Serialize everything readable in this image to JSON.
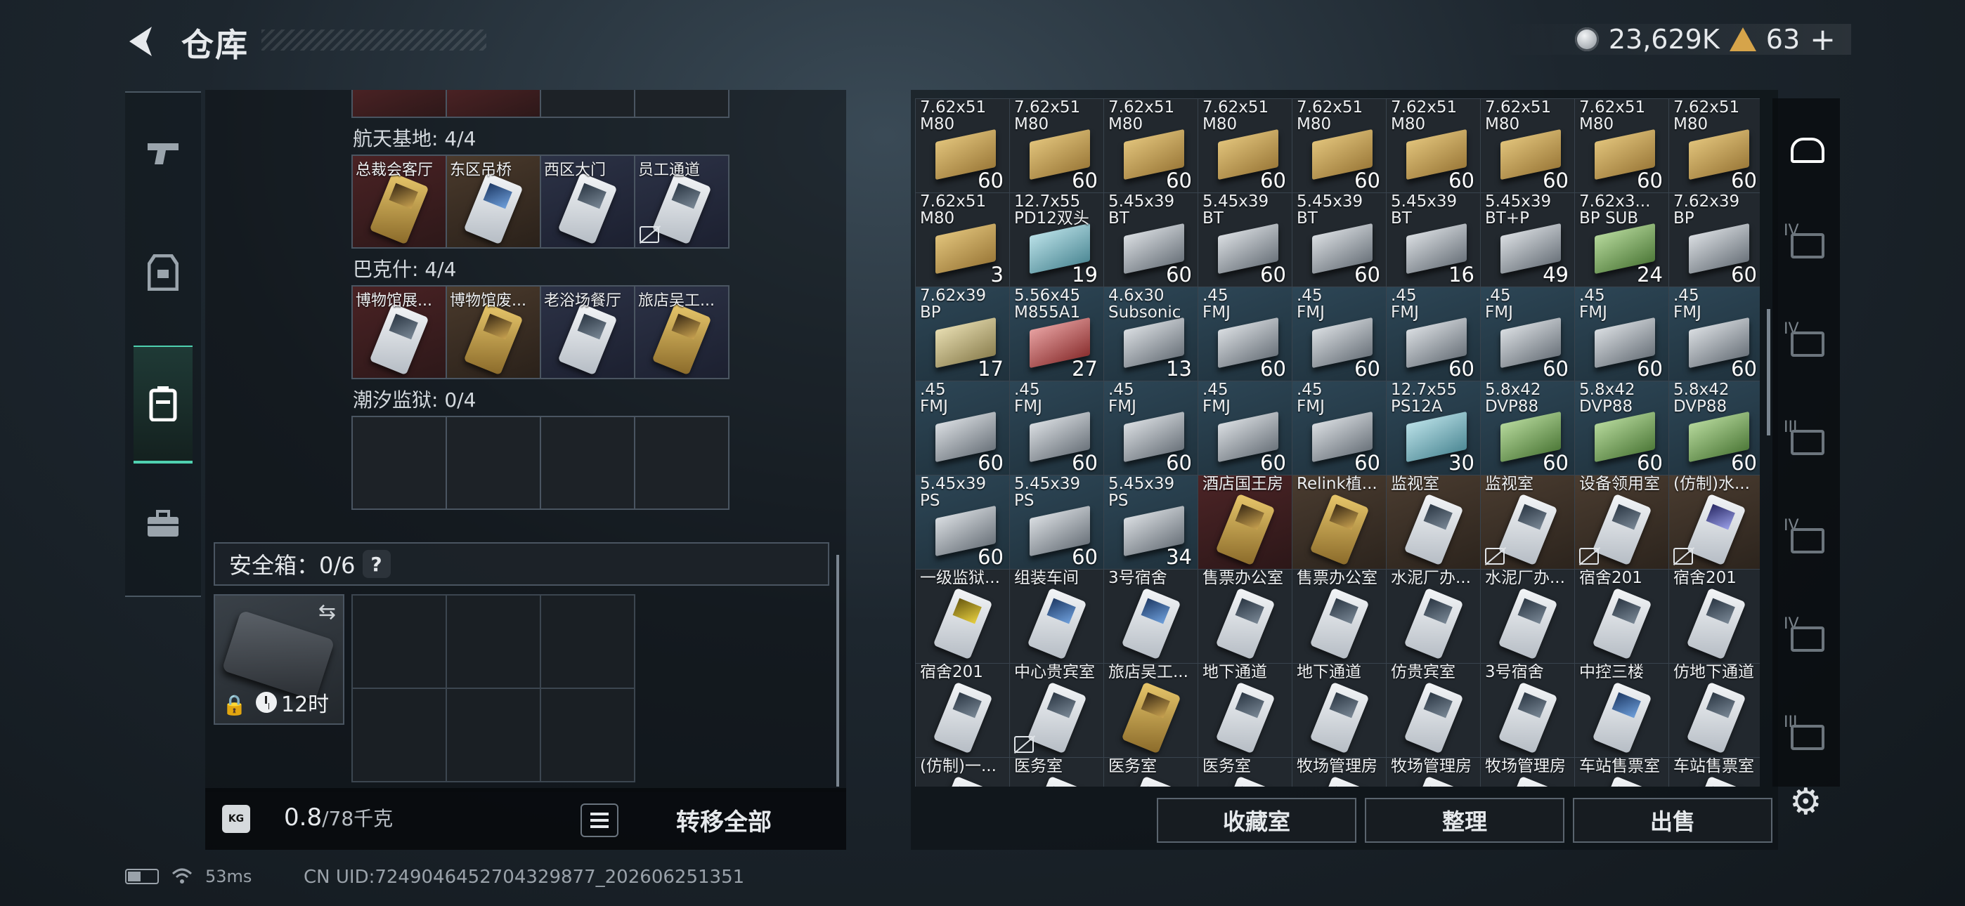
{
  "header": {
    "title": "仓库",
    "currency": "23,629K",
    "tokens": "63",
    "plus": "+"
  },
  "nav": {
    "items": [
      "weapon",
      "armor",
      "inventory",
      "toolbox"
    ],
    "selected": "inventory"
  },
  "sections": [
    {
      "label": "航天基地: 4/4",
      "cells": [
        {
          "name": "总裁会客厅",
          "bg": "red",
          "card": "goldc"
        },
        {
          "name": "东区吊桥",
          "bg": "brn",
          "card": "bluec"
        },
        {
          "name": "西区大门",
          "bg": "blu",
          "card": ""
        },
        {
          "name": "员工通道",
          "bg": "blu",
          "card": "",
          "nosale": true
        }
      ]
    },
    {
      "label": "巴克什: 4/4",
      "cells": [
        {
          "name": "博物馆展...",
          "bg": "red",
          "card": ""
        },
        {
          "name": "博物馆废...",
          "bg": "brn",
          "card": "goldc"
        },
        {
          "name": "老浴场餐厅",
          "bg": "blu",
          "card": ""
        },
        {
          "name": "旅店吴工...",
          "bg": "blu",
          "card": "goldc"
        }
      ]
    },
    {
      "label": "潮汐监狱: 0/4",
      "cells": []
    }
  ],
  "safe": {
    "label": "安全箱：0/6",
    "help": "?",
    "timer": "12时",
    "swap": "⇆",
    "lock": "🔒"
  },
  "weight": {
    "current": "0.8",
    "max": "/78千克",
    "kg": "KG"
  },
  "buttons": {
    "transfer_all": "转移全部",
    "favorites": "收藏室",
    "organize": "整理",
    "sell": "出售"
  },
  "status": {
    "ping": "53ms",
    "uid": "CN UID:7249046452704329877_202606251351"
  },
  "stash": [
    {
      "n": "7.62x51\nM80",
      "q": "60",
      "box": "gold",
      "bg": "gry"
    },
    {
      "n": "7.62x51\nM80",
      "q": "60",
      "box": "gold",
      "bg": "gry"
    },
    {
      "n": "7.62x51\nM80",
      "q": "60",
      "box": "gold",
      "bg": "gry"
    },
    {
      "n": "7.62x51\nM80",
      "q": "60",
      "box": "gold",
      "bg": "gry"
    },
    {
      "n": "7.62x51\nM80",
      "q": "60",
      "box": "gold",
      "bg": "gry"
    },
    {
      "n": "7.62x51\nM80",
      "q": "60",
      "box": "gold",
      "bg": "gry"
    },
    {
      "n": "7.62x51\nM80",
      "q": "60",
      "box": "gold",
      "bg": "gry"
    },
    {
      "n": "7.62x51\nM80",
      "q": "60",
      "box": "gold",
      "bg": "gry"
    },
    {
      "n": "7.62x51\nM80",
      "q": "60",
      "box": "gold",
      "bg": "gry"
    },
    {
      "n": "7.62x51\nM80",
      "q": "3",
      "box": "gold",
      "bg": "gry"
    },
    {
      "n": "12.7x55\nPD12双头",
      "q": "19",
      "box": "blue",
      "bg": "gry"
    },
    {
      "n": "5.45x39\nBT",
      "q": "60",
      "box": "silver",
      "bg": "gry"
    },
    {
      "n": "5.45x39\nBT",
      "q": "60",
      "box": "silver",
      "bg": "gry"
    },
    {
      "n": "5.45x39\nBT",
      "q": "60",
      "box": "silver",
      "bg": "gry"
    },
    {
      "n": "5.45x39\nBT",
      "q": "16",
      "box": "silver",
      "bg": "gry"
    },
    {
      "n": "5.45x39\nBT+P",
      "q": "49",
      "box": "silver",
      "bg": "gry"
    },
    {
      "n": "7.62x3...\nBP SUB",
      "q": "24",
      "box": "green",
      "bg": "gry"
    },
    {
      "n": "7.62x39\nBP",
      "q": "60",
      "box": "silver",
      "bg": "gry"
    },
    {
      "n": "7.62x39\nBP",
      "q": "17",
      "box": "tan",
      "bg": "blue"
    },
    {
      "n": "5.56x45\nM855A1",
      "q": "27",
      "box": "red",
      "bg": "blue"
    },
    {
      "n": "4.6x30\nSubsonic",
      "q": "13",
      "box": "silver",
      "bg": "blue"
    },
    {
      "n": ".45\nFMJ",
      "q": "60",
      "box": "silver",
      "bg": "blue"
    },
    {
      "n": ".45\nFMJ",
      "q": "60",
      "box": "silver",
      "bg": "blue"
    },
    {
      "n": ".45\nFMJ",
      "q": "60",
      "box": "silver",
      "bg": "blue"
    },
    {
      "n": ".45\nFMJ",
      "q": "60",
      "box": "silver",
      "bg": "blue"
    },
    {
      "n": ".45\nFMJ",
      "q": "60",
      "box": "silver",
      "bg": "blue"
    },
    {
      "n": ".45\nFMJ",
      "q": "60",
      "box": "silver",
      "bg": "blue"
    },
    {
      "n": ".45\nFMJ",
      "q": "60",
      "box": "silver",
      "bg": "blue"
    },
    {
      "n": ".45\nFMJ",
      "q": "60",
      "box": "silver",
      "bg": "blue"
    },
    {
      "n": ".45\nFMJ",
      "q": "60",
      "box": "silver",
      "bg": "blue"
    },
    {
      "n": ".45\nFMJ",
      "q": "60",
      "box": "silver",
      "bg": "blue"
    },
    {
      "n": ".45\nFMJ",
      "q": "60",
      "box": "silver",
      "bg": "blue"
    },
    {
      "n": "12.7x55\nPS12A",
      "q": "30",
      "box": "blue",
      "bg": "blue"
    },
    {
      "n": "5.8x42\nDVP88",
      "q": "60",
      "box": "green",
      "bg": "blue"
    },
    {
      "n": "5.8x42\nDVP88",
      "q": "60",
      "box": "green",
      "bg": "blue"
    },
    {
      "n": "5.8x42\nDVP88",
      "q": "60",
      "box": "green",
      "bg": "blue"
    },
    {
      "n": "5.45x39\nPS",
      "q": "60",
      "box": "silver",
      "bg": "blue"
    },
    {
      "n": "5.45x39\nPS",
      "q": "60",
      "box": "silver",
      "bg": "blue"
    },
    {
      "n": "5.45x39\nPS",
      "q": "34",
      "box": "silver",
      "bg": "blue"
    },
    {
      "n": "酒店国王房",
      "q": "",
      "card": "goldc",
      "bg": "red"
    },
    {
      "n": "Relink植...",
      "q": "",
      "card": "goldc",
      "bg": "brn"
    },
    {
      "n": "监视室",
      "q": "",
      "card": "",
      "bg": "brn"
    },
    {
      "n": "监视室",
      "q": "",
      "card": "",
      "bg": "brn",
      "nosale": true
    },
    {
      "n": "设备领用室",
      "q": "",
      "card": "",
      "bg": "brn",
      "nosale": true
    },
    {
      "n": "(仿制)水...",
      "q": "",
      "card": "bluec2",
      "bg": "brn",
      "nosale": true
    },
    {
      "n": "一级监狱...",
      "q": "",
      "card": "yel",
      "bg": "gry"
    },
    {
      "n": "组装车间",
      "q": "",
      "card": "bluec",
      "bg": "gry"
    },
    {
      "n": "3号宿舍",
      "q": "",
      "card": "bluec",
      "bg": "gry"
    },
    {
      "n": "售票办公室",
      "q": "",
      "card": "",
      "bg": "gry"
    },
    {
      "n": "售票办公室",
      "q": "",
      "card": "",
      "bg": "gry"
    },
    {
      "n": "水泥厂办...",
      "q": "",
      "card": "",
      "bg": "gry"
    },
    {
      "n": "水泥厂办...",
      "q": "",
      "card": "",
      "bg": "gry"
    },
    {
      "n": "宿舍201",
      "q": "",
      "card": "",
      "bg": "gry"
    },
    {
      "n": "宿舍201",
      "q": "",
      "card": "",
      "bg": "gry"
    },
    {
      "n": "宿舍201",
      "q": "",
      "card": "",
      "bg": "gry"
    },
    {
      "n": "中心贵宾室",
      "q": "",
      "card": "",
      "bg": "gry",
      "nosale": true
    },
    {
      "n": "旅店吴工...",
      "q": "",
      "card": "goldc",
      "bg": "gry"
    },
    {
      "n": "地下通道",
      "q": "",
      "card": "",
      "bg": "gry"
    },
    {
      "n": "地下通道",
      "q": "",
      "card": "",
      "bg": "gry"
    },
    {
      "n": "仿贵宾室",
      "q": "",
      "card": "",
      "bg": "gry"
    },
    {
      "n": "3号宿舍",
      "q": "",
      "card": "",
      "bg": "gry"
    },
    {
      "n": "中控三楼",
      "q": "",
      "card": "bluec",
      "bg": "gry"
    },
    {
      "n": "仿地下通道",
      "q": "",
      "card": "",
      "bg": "gry"
    },
    {
      "n": "(仿制)一...",
      "q": "",
      "card": "",
      "bg": "gry"
    },
    {
      "n": "医务室",
      "q": "",
      "card": "",
      "bg": "gry"
    },
    {
      "n": "医务室",
      "q": "",
      "card": "",
      "bg": "gry"
    },
    {
      "n": "医务室",
      "q": "",
      "card": "",
      "bg": "gry"
    },
    {
      "n": "牧场管理房",
      "q": "",
      "card": "",
      "bg": "gry"
    },
    {
      "n": "牧场管理房",
      "q": "",
      "card": "",
      "bg": "gry"
    },
    {
      "n": "牧场管理房",
      "q": "",
      "card": "",
      "bg": "gry"
    },
    {
      "n": "车站售票室",
      "q": "",
      "card": "",
      "bg": "gry"
    },
    {
      "n": "车站售票室",
      "q": "",
      "card": "",
      "bg": "gry"
    }
  ],
  "right_tabs": {
    "tier_labels": [
      "IV",
      "IV",
      "III",
      "IV",
      "IV",
      "III"
    ]
  }
}
